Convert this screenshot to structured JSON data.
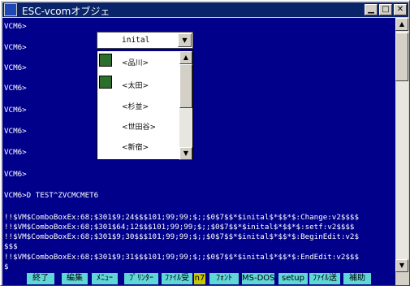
{
  "window": {
    "title": "ESC-vcomオブジェ"
  },
  "terminal": {
    "lines": [
      "VCM6>",
      "VCM6>",
      "VCM6>",
      "VCM6>",
      "VCM6>",
      "VCM6>",
      "VCM6>",
      "VCM6>",
      "VCM6>D TEST^ZVCMCMET6",
      "!!$VM$ComboBoxEx:68;$301$9;24$$$101;99;99;$;;$0$7$$*$inital$*$$*$:Change:v2$$$$",
      "!!$VM$ComboBoxEx:68;$301$64;12$$$101;99;99;$;;$0$7$$*$inital$*$$*$:setf:v2$$$$",
      "!!$VM$ComboBoxEx:68;$301$9;30$$$101;99;99;$;;$0$7$$*$inital$*$$*$:BeginEdit:v2$",
      "$$$",
      "!!$VM$ComboBoxEx:68;$301$9;31$$$101;99;99;$;;$0$7$$*$inital$*$$*$:EndEdit:v2$$$",
      "$"
    ]
  },
  "combo": {
    "value": "inital",
    "items": [
      "<品川>",
      "<太田>",
      "<杉並>",
      "<世田谷>",
      "<新宿>"
    ]
  },
  "fkeys": [
    "終了",
    "編集",
    "ﾒﾆｭｰ",
    "ﾌﾟﾘﾝﾀｰ",
    "ﾌｧｲﾙ受",
    "n7",
    "ﾌｫﾝﾄ",
    "MS-DOS",
    "setup",
    "ﾌｧｲﾙ送",
    "補助"
  ]
}
